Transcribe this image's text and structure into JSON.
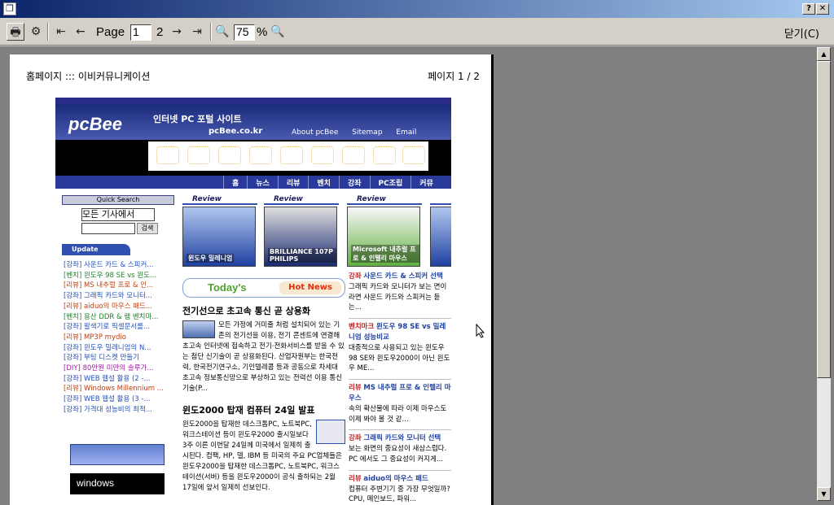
{
  "window": {
    "title": ""
  },
  "toolbar": {
    "page_label": "Page",
    "page_value": "1",
    "page_total": "2",
    "zoom_value": "75",
    "zoom_unit": "%",
    "close_label": "닫기(C)"
  },
  "page": {
    "header_left": "홈페이지 ::: 이비커뮤니케이션",
    "header_right": "페이지 1 / 2"
  },
  "site": {
    "logo": "pcBee",
    "portal_title": "인터넷 PC 포털 사이트",
    "domain": "pcBee.co.kr",
    "top_links": [
      "About pcBee",
      "Sitemap",
      "Email"
    ],
    "menu": [
      "홈",
      "뉴스",
      "리뷰",
      "벤치",
      "강좌",
      "PC조립",
      "커뮤"
    ],
    "quick_search_label": "Quick Search",
    "search_select": "모든 기사에서",
    "search_button": "검색",
    "update_label": "Update",
    "update_items": [
      "[강좌] 사운드 카드 & 스피커...",
      "[벤치] 윈도우 98 SE vs 윈도...",
      "[리뷰] MS 내추럴 프로 & 인...",
      "[강좌] 그래픽 카드와 모니터...",
      "[리뷰] aiduo의 마우스 패드...",
      "[벤치] 용산 DDR & 램 벤치마...",
      "[강좌] 팔색기로 픽셀문서롤...",
      "[리뷰] MP3P mydio",
      "[강좌] 윈도우 밀레니엄의 N...",
      "[강좌] 부팅 디스켓 만들기",
      "[DIY] 80만원 미만의 솔루가...",
      "[강좌] WEB 웹설 활용 (2 -...",
      "[리뷰] Windows Millennium ...",
      "[강좌] WEB 웹설 활용 (3 -...",
      "[강좌] 가격대 성능비의 최적..."
    ],
    "windows_ad": "windows",
    "review_label": "Review",
    "reviews": [
      "윈도우 밀레니엄",
      "BRILLIANCE 107P PHILIPS",
      "Microsoft 내추럴 프로 & 인텔리 마우스"
    ],
    "today_label": "Today's",
    "hot_news_label": "Hot News",
    "article1_title": "전기선으로 초고속 통신 곧 상용화",
    "article1_body": "모든 가정에 거미줄 처럼 설치되어 있는 기존의 전기선을 이용, 전기 콘센트에 연결해 초고속 인터넷에 접속하고 전기·전화서비스를 받을 수 있는 첨단 신기술이 곧 상용화된다. 산업자원부는 한국전력, 한국전기연구소, 기인텔레콤 등과 공동으로 차세대 초고속 정보통신망으로 부상하고 있는 전력선 이용 통신기술(P...",
    "article2_title": "윈도2000 탑재 컴퓨터 24일 발표",
    "article2_body": "윈도2000을 탑재한 데스크톱PC, 노트북PC, 워크스테이션 등이 윈도우2000 출시일보다 3주 이른 이번달 24일께 미국에서 일제히 출시된다. 컴팩, HP, 델, IBM 등 미국의 주요 PC업체들은 윈도우2000을 탑재한 데스크톱PC, 노트북PC, 워크스테이션(서버) 등을 윈도우2000이 공식 출하되는 2월 17일에 앞서 일제히 선보인다.",
    "right_items": [
      {
        "tag": "강좌",
        "title": "사운드 카드 & 스피커 선택",
        "body": "그래픽 카드와 모니터가 보는 면이라면 사운드 카드와 스피커는 듣는..."
      },
      {
        "tag": "벤치마크",
        "title": "윈도우 98 SE vs 밀레니엄 성능비교",
        "body": "대중적으로 사용되고 있는 윈도우 98 SE와 윈도우2000이 아닌 윈도우 ME..."
      },
      {
        "tag": "리뷰",
        "title": "MS 내추럴 프로 & 인텔리 마우스",
        "body": "속의 확산물에 따라 이제 마우스도 이제 봐야 볼 것 같..."
      },
      {
        "tag": "강좌",
        "title": "그래픽 카드와 모니터 선택",
        "body": "보는 화면의 중요성이 새삼스럽다. PC 에서도 그 중요성이 커지게..."
      },
      {
        "tag": "리뷰",
        "title": "aiduo의 마우스 패드",
        "body": "컴퓨터 주변기기 중 가장 무엇일까? CPU, 메인보드, 파워..."
      }
    ]
  }
}
